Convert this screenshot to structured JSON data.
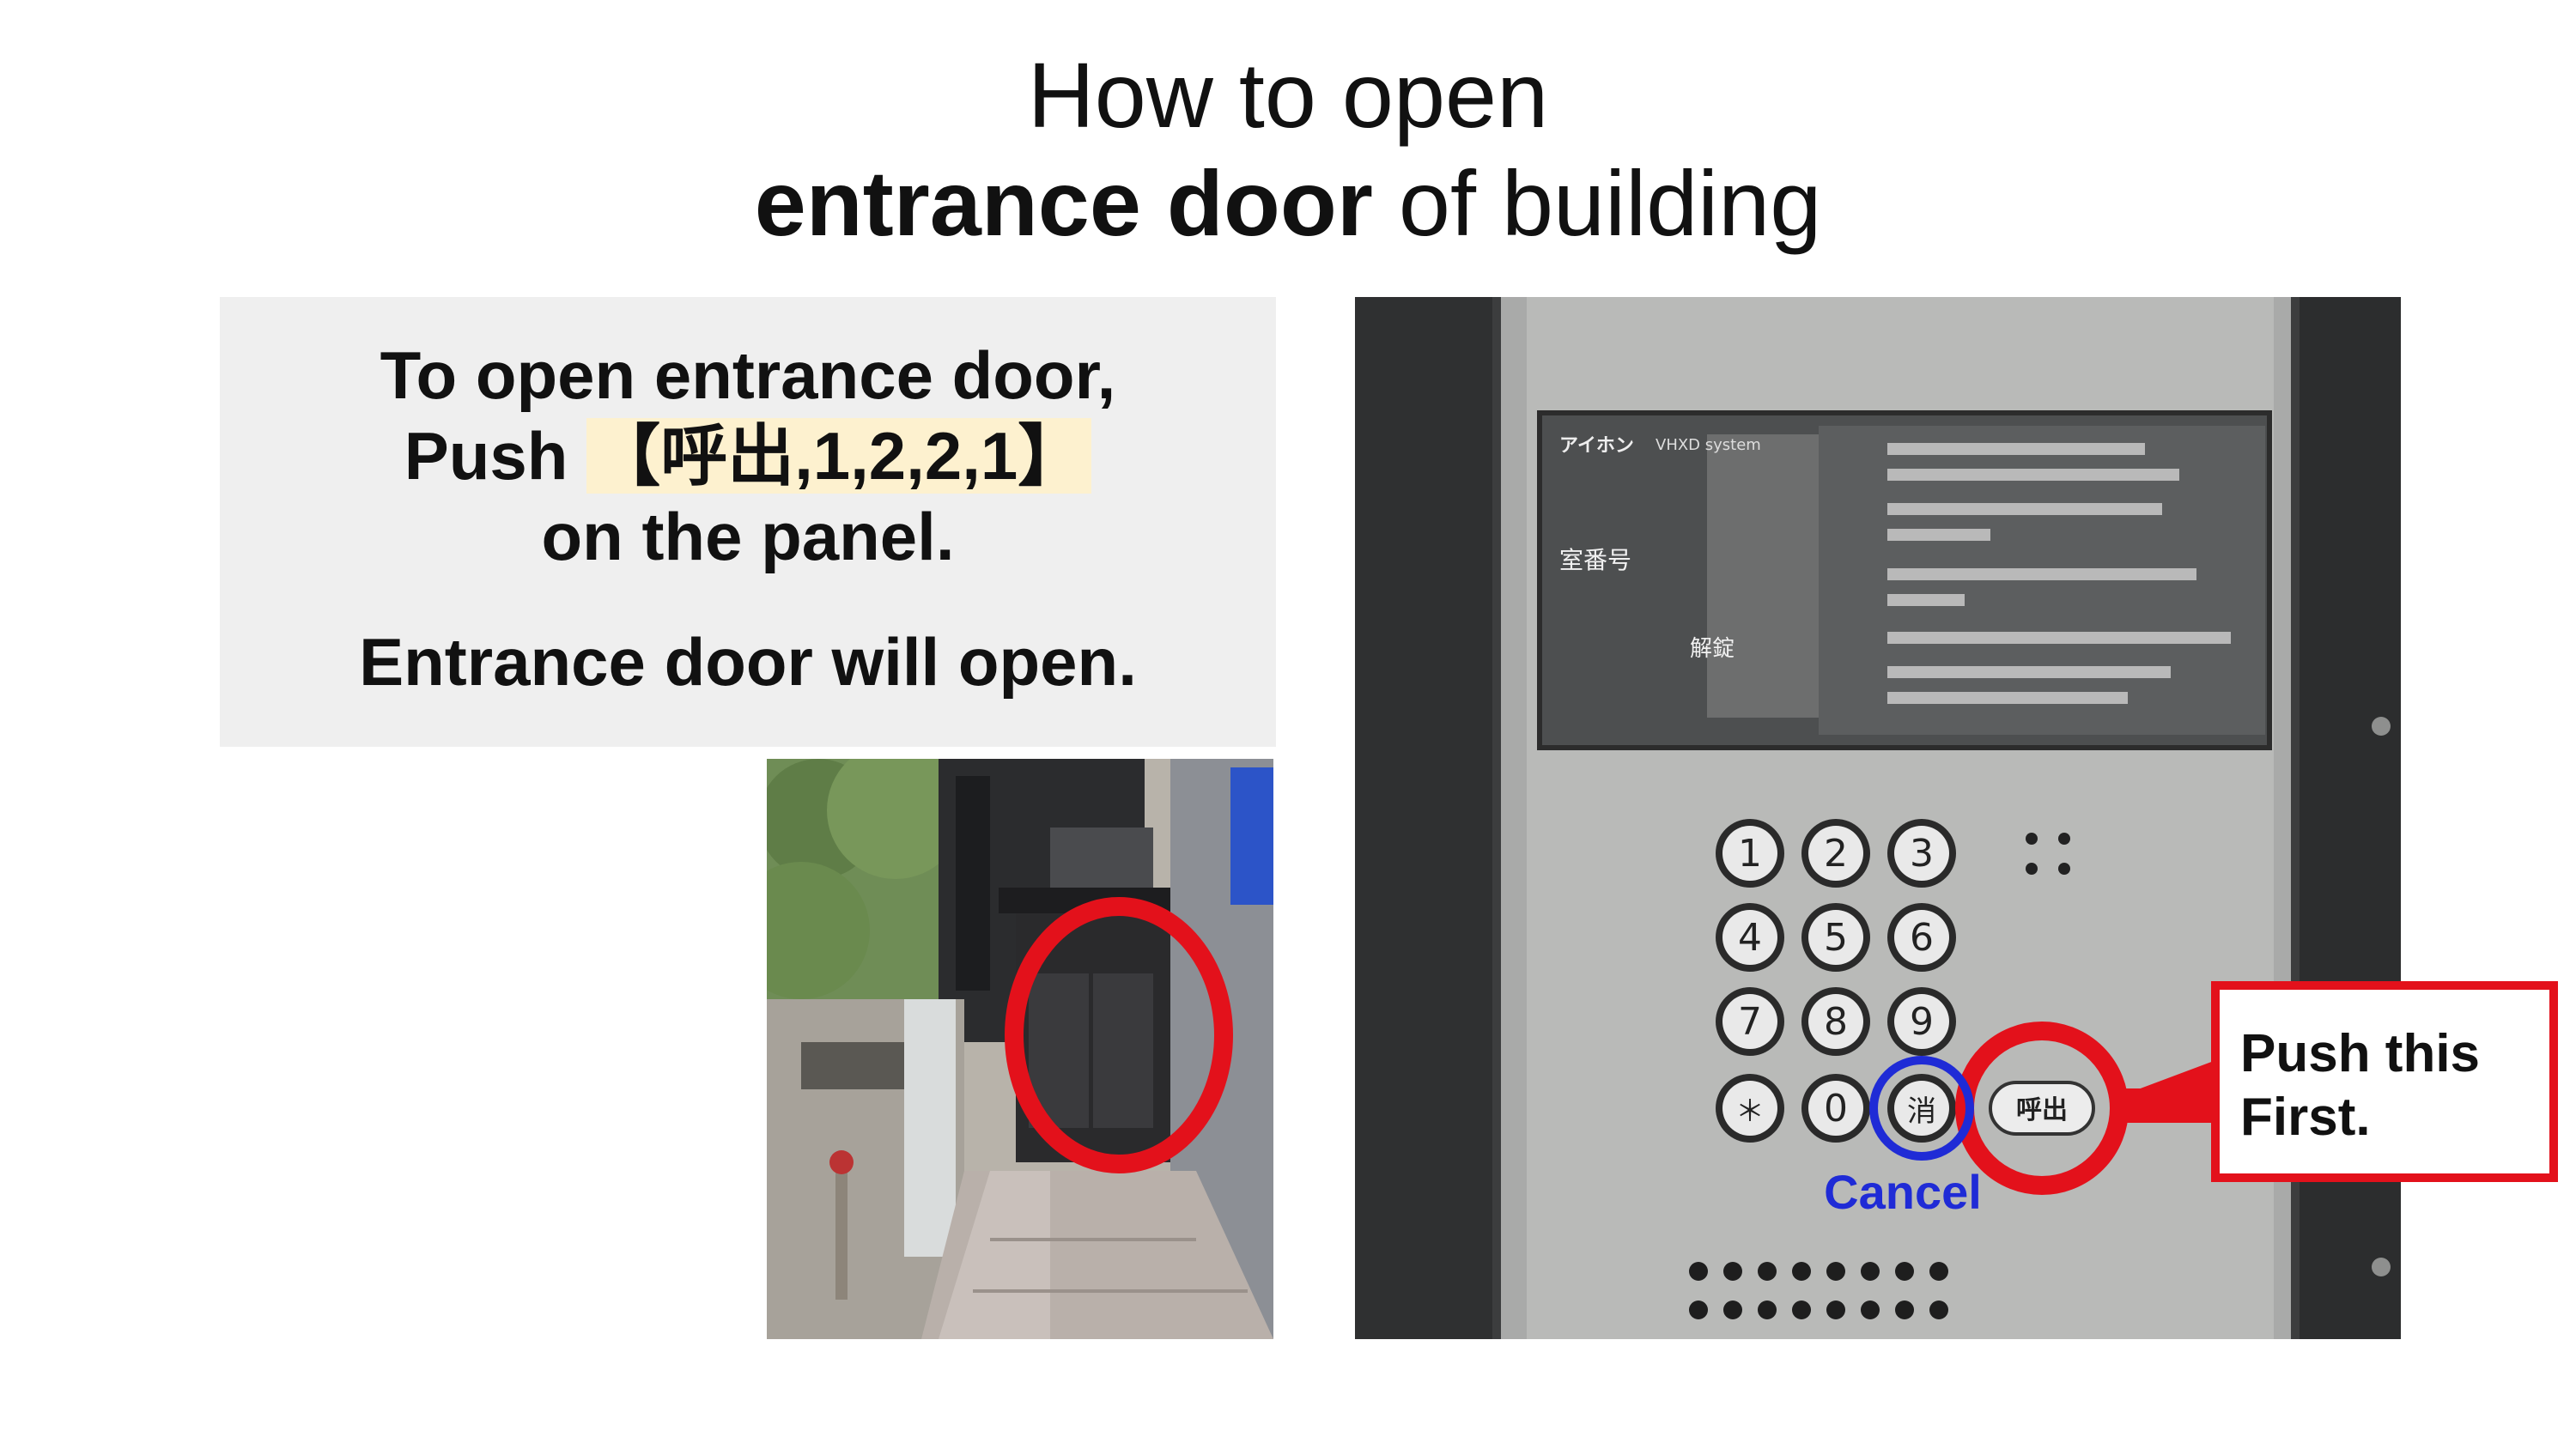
{
  "title": {
    "line1": "How to open",
    "line2_bold": "entrance door",
    "line2_rest": " of building"
  },
  "instructions": {
    "line1": "To open entrance door,",
    "line2_prefix": "Push ",
    "line2_highlight": "【呼出,1,2,2,1】",
    "line3": "on the panel.",
    "result": "Entrance door will open."
  },
  "panel": {
    "brand": "アイホン",
    "system": "VHXD system",
    "room_label": "室番号",
    "unlock_label": "解錠",
    "keys": [
      "1",
      "2",
      "3",
      "4",
      "5",
      "6",
      "7",
      "8",
      "9",
      "＊",
      "0",
      "消"
    ],
    "call_key": "呼出",
    "cancel_label": "Cancel",
    "callout_line1": "Push this",
    "callout_line2": "First."
  },
  "colors": {
    "callout_red": "#e3111b",
    "cancel_blue": "#1f2bd6",
    "highlight": "#fdf1cf",
    "textbox_bg": "#efefef"
  }
}
